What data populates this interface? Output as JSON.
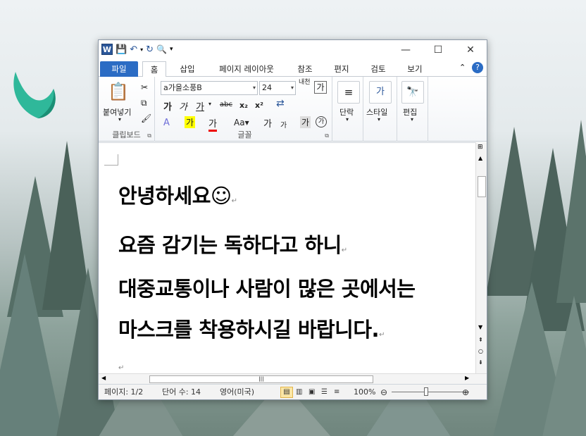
{
  "window": {
    "tabs": [
      "파일",
      "홈",
      "삽입",
      "페이지 레이아웃",
      "참조",
      "편지",
      "검토",
      "보기"
    ],
    "active_tab": "홈"
  },
  "ribbon": {
    "clipboard": {
      "paste_label": "붙여넣기",
      "group_label": "클립보드"
    },
    "font": {
      "font_name": "a가을소풍B",
      "font_size": "24",
      "group_label": "글꼴",
      "grow_label": "내천",
      "btn_char": "가"
    },
    "paragraph": {
      "label": "단락"
    },
    "styles": {
      "label": "스타일"
    },
    "editing": {
      "label": "편집"
    }
  },
  "document": {
    "lines": [
      "안녕하세요☺",
      "요즘 감기는 독하다고 하니",
      "대중교통이나 사람이 많은 곳에서는",
      "마스크를 착용하시길 바랍니다."
    ]
  },
  "status": {
    "page": "페이지: 1/2",
    "words": "단어 수: 14",
    "language": "영어(미국)",
    "zoom": "100%"
  },
  "colors": {
    "file_tab": "#2b6cc4",
    "word_blue": "#2b579a"
  }
}
